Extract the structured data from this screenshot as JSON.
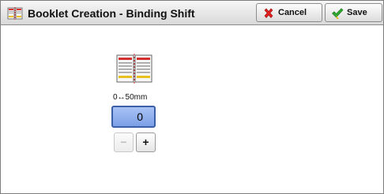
{
  "window": {
    "title": "Booklet Creation - Binding Shift",
    "title_icon": "booklet-icon"
  },
  "toolbar": {
    "cancel_label": "Cancel",
    "cancel_icon": "red-x-icon",
    "save_label": "Save",
    "save_icon": "green-check-icon"
  },
  "binding_shift": {
    "range_label": "0↔50mm",
    "value": "0",
    "decrement_label": "−",
    "increment_label": "+",
    "decrement_enabled": false,
    "increment_enabled": true
  },
  "colors": {
    "field_fill": "#8fb0ee",
    "field_border": "#3b5fa6",
    "cancel_icon": "#e02020",
    "save_icon": "#2ea82e"
  }
}
